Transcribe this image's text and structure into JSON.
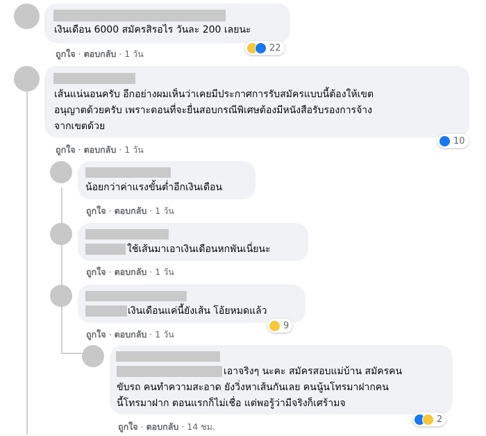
{
  "comments": [
    {
      "author": "",
      "text_lines": [
        "เงินเดือน 6000 สมัครสิรอไร วันละ 200 เลยนะ"
      ],
      "like_label": "ถูกใจ",
      "reply_label": "ตอบกลับ",
      "time": "1 วัน",
      "reactions": [
        "haha",
        "like"
      ],
      "reaction_count": "22"
    },
    {
      "author": "",
      "text_lines": [
        "เส้นแน่นอนครับ อีกอย่างผมเห็นว่าเคยมีประกาศการรับสมัครแบบนี้ต้องให้เขต",
        "อนุญาตด้วยครับ เพราะตอนที่จะยื่นสอบกรณีพิเศษต้องมีหนังสือรับรองการจ้าง",
        "จากเขตด้วย"
      ],
      "like_label": "ถูกใจ",
      "reply_label": "ตอบกลับ",
      "time": "1 วัน",
      "reactions": [
        "like"
      ],
      "reaction_count": "10"
    },
    {
      "author": "",
      "text_lines": [
        "น้อยกว่าค่าแรงขั้นต่ำอีกเงินเดือน"
      ],
      "like_label": "ถูกใจ",
      "reply_label": "ตอบกลับ",
      "time": "1 วัน"
    },
    {
      "author": "",
      "mention": "",
      "text_lines": [
        "ใช้เส้นมาเอาเงินเดือนหกพันเนี่ยนะ"
      ],
      "like_label": "ถูกใจ",
      "reply_label": "ตอบกลับ",
      "time": "1 วัน"
    },
    {
      "author": "",
      "mention": "",
      "text_lines": [
        "เงินเดือนแค่นี้ยังเส้น โอ้ยหมดแล้ว"
      ],
      "like_label": "ถูกใจ",
      "reply_label": "ตอบกลับ",
      "time": "1 วัน",
      "reactions": [
        "haha"
      ],
      "reaction_count": "9"
    },
    {
      "author": "",
      "mention": "",
      "text_lines": [
        "เอาจริงๆ นะคะ สมัครสอบแม่บ้าน สมัครคน",
        "ขับรถ คนทำความสะอาด ยังวิ่งหาเส้นกันเลย คนนู้นโทรมาฝากคน",
        "นี้โทรมาฝาก ตอนแรกก็ไม่เชื่อ แต่พอรู้ว่ามีจริงก็เศร้ามจ"
      ],
      "like_label": "ถูกใจ",
      "reply_label": "ตอบกลับ",
      "time": "14 ชม.",
      "reactions": [
        "like",
        "sad"
      ],
      "reaction_count": "2"
    }
  ],
  "separator": "·",
  "colors": {
    "bubble": "#f0f2f5",
    "secondary_text": "#65676b",
    "like_blue": "#1877f2",
    "haha_yellow": "#f7c738",
    "redaction": "#c9c9c9"
  }
}
